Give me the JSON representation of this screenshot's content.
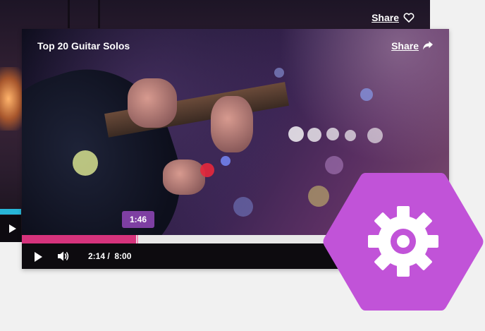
{
  "back_player": {
    "share_label": "Share",
    "share_icon": "heart-icon",
    "play_icon": "play-icon"
  },
  "player": {
    "title": "Top 20 Guitar Solos",
    "share_label": "Share",
    "share_icon": "share-arrow-icon",
    "hover_time": "1:46",
    "current_time": "2:14",
    "separator": "/",
    "duration": "8:00",
    "progress_fraction": 0.2675,
    "play_icon": "play-icon",
    "volume_icon": "volume-icon",
    "accent_color": "#d6337c",
    "tooltip_color": "#7e3fa2"
  },
  "settings": {
    "icon": "gear-icon",
    "badge_color": "#c153d8"
  }
}
